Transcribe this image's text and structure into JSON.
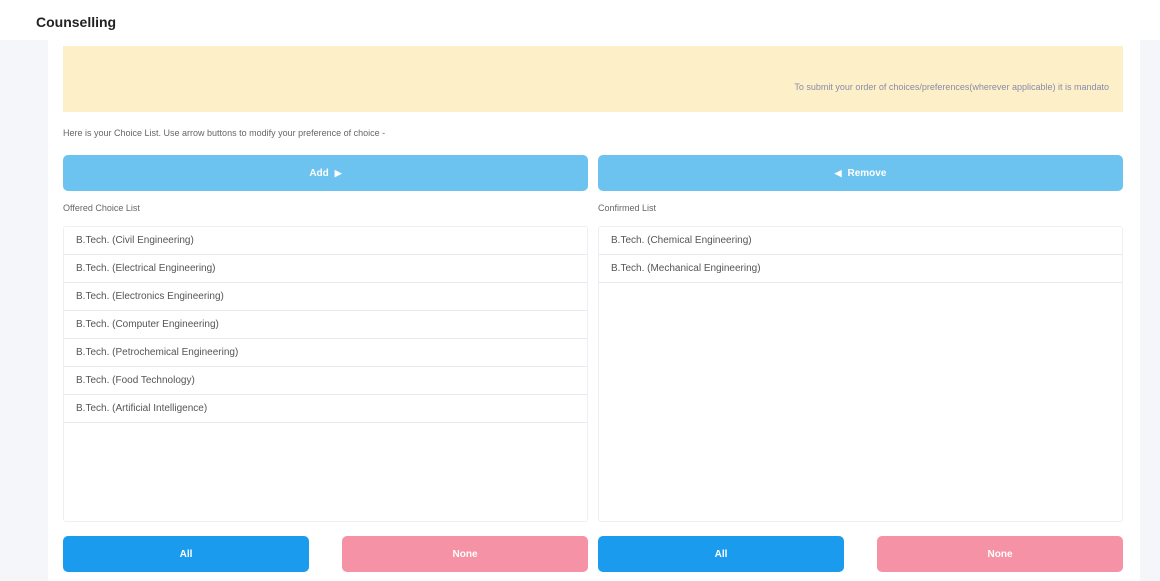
{
  "header": {
    "title": "Counselling"
  },
  "notice": {
    "text": "To submit your order of choices/preferences(wherever applicable) it is mandato"
  },
  "instruction": "Here is your Choice List. Use arrow buttons to modify your preference of choice -",
  "buttons": {
    "add": "Add",
    "remove": "Remove",
    "all_left": "All",
    "none_left": "None",
    "all_right": "All",
    "none_right": "None"
  },
  "offered": {
    "label": "Offered Choice List",
    "items": [
      "B.Tech. (Civil Engineering)",
      "B.Tech. (Electrical Engineering)",
      "B.Tech. (Electronics Engineering)",
      "B.Tech. (Computer Engineering)",
      "B.Tech. (Petrochemical Engineering)",
      "B.Tech. (Food Technology)",
      "B.Tech. (Artificial Intelligence)"
    ]
  },
  "confirmed": {
    "label": "Confirmed List",
    "items": [
      "B.Tech. (Chemical Engineering)",
      "B.Tech. (Mechanical Engineering)"
    ]
  },
  "icons": {
    "add": "triangle-right-icon",
    "remove": "triangle-left-icon"
  },
  "colors": {
    "move_button": "#6cc3f0",
    "all_button": "#1a9bee",
    "none_button": "#f592a5",
    "notice_bg": "#fdf0c9"
  }
}
